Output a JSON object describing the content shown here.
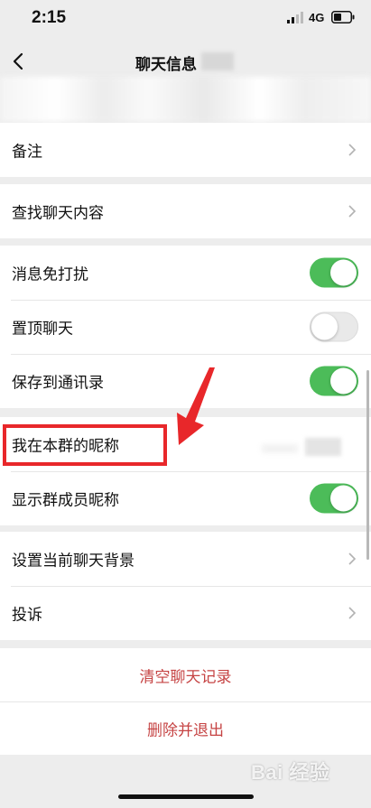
{
  "status_bar": {
    "time": "2:15",
    "network": "4G"
  },
  "nav": {
    "title": "聊天信息"
  },
  "groups": {
    "remark": {
      "label": "备注"
    },
    "search": {
      "label": "查找聊天内容"
    },
    "settings": [
      {
        "label": "消息免打扰",
        "toggle": "on"
      },
      {
        "label": "置顶聊天",
        "toggle": "off"
      },
      {
        "label": "保存到通讯录",
        "toggle": "on"
      }
    ],
    "nickname": [
      {
        "label": "我在本群的昵称"
      },
      {
        "label": "显示群成员昵称",
        "toggle": "on"
      }
    ],
    "misc": [
      {
        "label": "设置当前聊天背景"
      },
      {
        "label": "投诉"
      }
    ],
    "actions": [
      {
        "label": "清空聊天记录"
      },
      {
        "label": "删除并退出"
      }
    ]
  },
  "colors": {
    "toggle_on": "#4cbc59",
    "danger_text": "#c64444",
    "annotation_red": "#e8272a"
  },
  "watermark": "Bai 经验"
}
